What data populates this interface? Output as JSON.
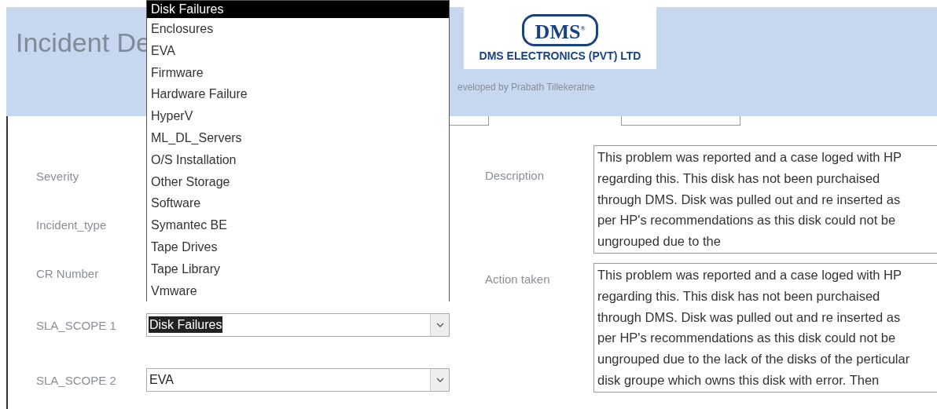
{
  "header": {
    "title": "Incident De",
    "logo": {
      "mark": "DMS$^{®}$",
      "company": "DMS ELECTRONICS (PVT) LTD"
    },
    "credit": "eveloped by Prabath Tillekeratne"
  },
  "fields": [
    {
      "kind": "label",
      "label": "Severity"
    },
    {
      "kind": "label",
      "label": "Incident_type"
    },
    {
      "kind": "label",
      "label": "CR Number"
    },
    {
      "kind": "combo",
      "label": "SLA_SCOPE 1",
      "value": "Disk Failures",
      "highlighted": true
    },
    {
      "kind": "combo",
      "label": "SLA_SCOPE 2",
      "value": "EVA",
      "highlighted": false
    }
  ],
  "memos": [
    {
      "label": "Description",
      "text": "This problem was reported and a case loged with HP regarding this. This disk has not been purchaised through DMS. Disk was pulled out and re inserted as per HP's recommendations as this disk could not be ungrouped due to the"
    },
    {
      "label": "Action taken",
      "text": "This problem was reported and a case loged with HP regarding this. This disk has not been purchaised through DMS. Disk was pulled out and re inserted as per HP's recommendations as this disk could not be ungrouped due to the lack of the disks of the perticular disk groupe which owns this disk with error. Then"
    }
  ],
  "dropdown": [
    {
      "label": "Disk Failures",
      "selected": true
    },
    {
      "label": "Enclosures",
      "selected": false
    },
    {
      "label": "EVA",
      "selected": false
    },
    {
      "label": "Firmware",
      "selected": false
    },
    {
      "label": "Hardware Failure",
      "selected": false
    },
    {
      "label": "HyperV",
      "selected": false
    },
    {
      "label": "ML_DL_Servers",
      "selected": false
    },
    {
      "label": "O/S Installation",
      "selected": false
    },
    {
      "label": "Other Storage",
      "selected": false
    },
    {
      "label": "Software",
      "selected": false
    },
    {
      "label": "Symantec BE",
      "selected": false
    },
    {
      "label": "Tape Drives",
      "selected": false
    },
    {
      "label": "Tape Library",
      "selected": false
    },
    {
      "label": "Vmware",
      "selected": false
    }
  ]
}
